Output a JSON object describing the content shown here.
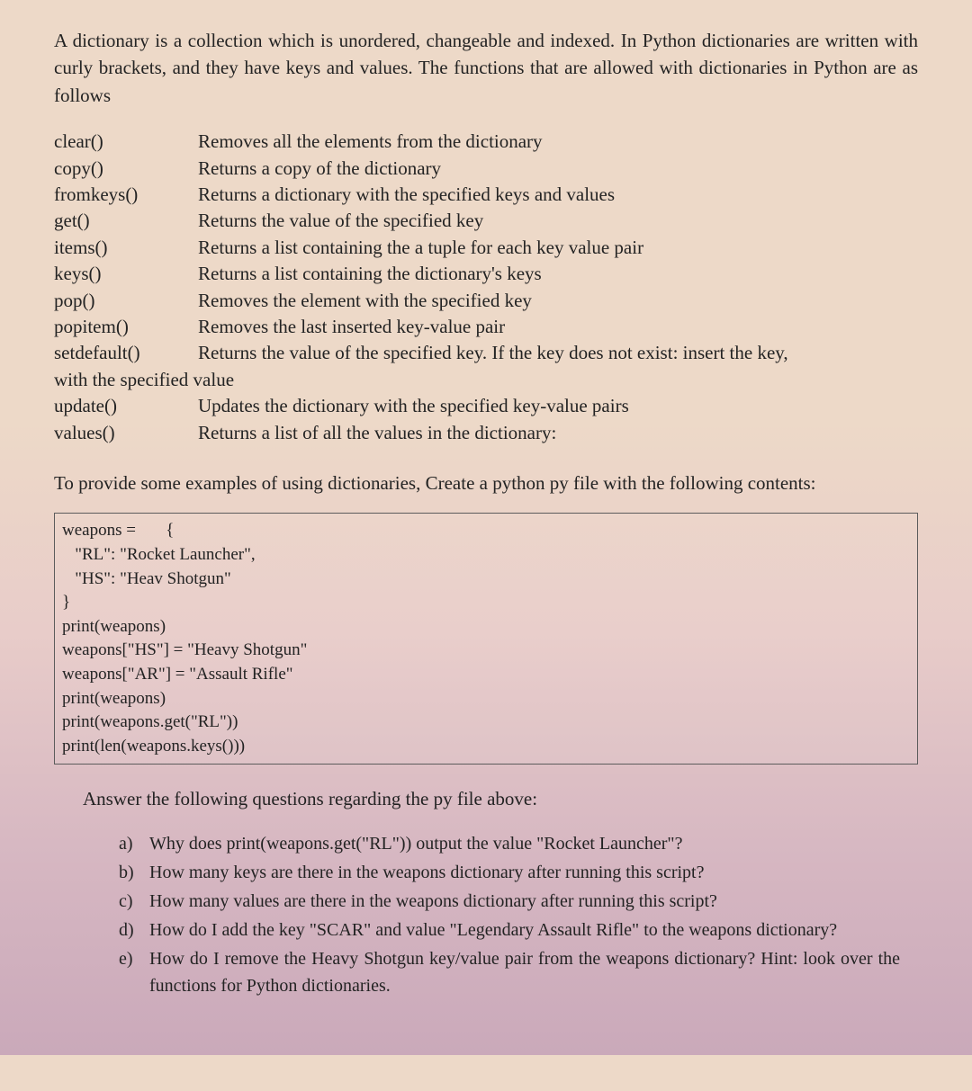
{
  "intro": "A dictionary is a collection which is unordered, changeable and indexed. In Python dictionaries are written with curly brackets, and they have keys and values. The functions that are allowed with dictionaries in Python are as follows",
  "methods": [
    {
      "name": "clear()",
      "desc": "Removes all the elements from the dictionary"
    },
    {
      "name": "copy()",
      "desc": "Returns a copy of the dictionary"
    },
    {
      "name": "fromkeys()",
      "desc": "Returns a dictionary with the specified keys and values"
    },
    {
      "name": "get()",
      "desc": "Returns the value of the specified key"
    },
    {
      "name": "items()",
      "desc": "Returns a list containing the a tuple for each key value pair"
    },
    {
      "name": "keys()",
      "desc": "Returns a list containing the dictionary's keys"
    },
    {
      "name": "pop()",
      "desc": "Removes the element with the specified key"
    },
    {
      "name": "popitem()",
      "desc": "Removes the last inserted key-value pair"
    },
    {
      "name": "setdefault()",
      "desc": "Returns the value of the specified key. If the key does not exist: insert the key,"
    }
  ],
  "method_wrap": "with the specified value",
  "methods_tail": [
    {
      "name": "update()",
      "desc": "Updates the dictionary with the specified key-value pairs"
    },
    {
      "name": "values()",
      "desc": "Returns a list of all the values in the dictionary:"
    }
  ],
  "example_intro": "To provide some examples of using dictionaries, Create a python py file with the following contents:",
  "code": "weapons =       {\n   \"RL\": \"Rocket Launcher\",\n   \"HS\": \"Heav Shotgun\"\n}\nprint(weapons)\nweapons[\"HS\"] = \"Heavy Shotgun\"\nweapons[\"AR\"] = \"Assault Rifle\"\nprint(weapons)\nprint(weapons.get(\"RL\"))\nprint(len(weapons.keys()))",
  "answer_intro": "Answer the following questions regarding the py file above:",
  "questions": [
    {
      "label": "a)",
      "text": "Why does print(weapons.get(\"RL\")) output the value \"Rocket Launcher\"?"
    },
    {
      "label": "b)",
      "text": "How many keys are there in the weapons dictionary after running this script?"
    },
    {
      "label": "c)",
      "text": "How many values are there in the weapons dictionary after running this script?"
    },
    {
      "label": "d)",
      "text": "How do I add the key \"SCAR\" and value \"Legendary Assault Rifle\" to the weapons dictionary?"
    },
    {
      "label": "e)",
      "text": "How do I remove the Heavy Shotgun key/value pair from the weapons dictionary? Hint: look over the functions for Python dictionaries."
    }
  ]
}
